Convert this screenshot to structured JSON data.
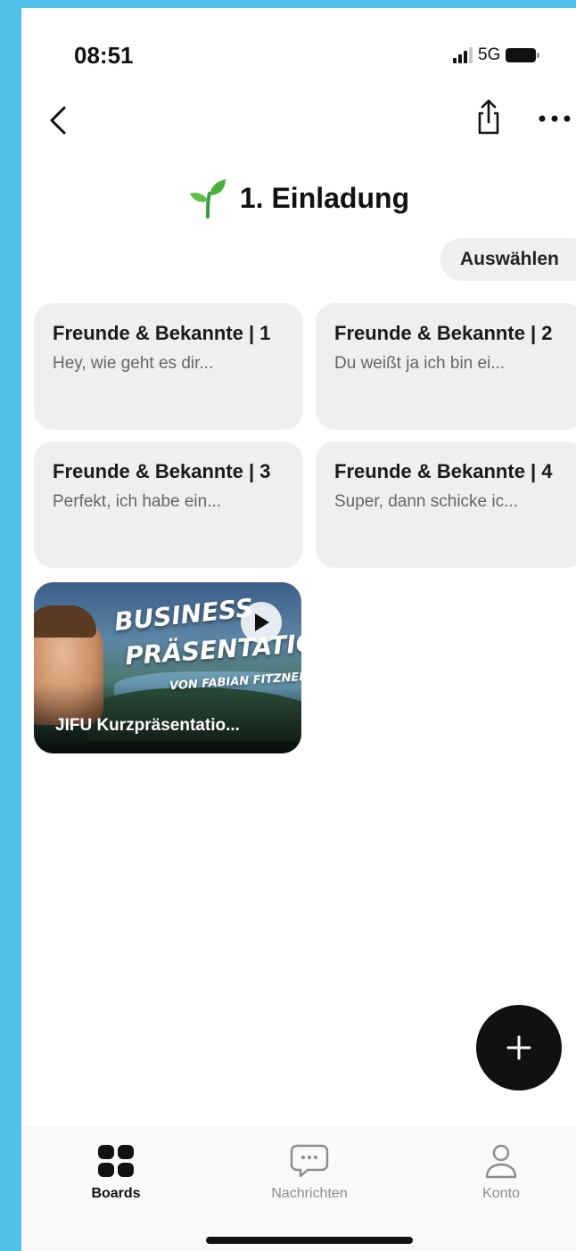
{
  "status_bar": {
    "time": "08:51",
    "network": "5G"
  },
  "header": {
    "title": "1. Einladung",
    "select_label": "Auswählen"
  },
  "cards": [
    {
      "title": "Freunde & Bekannte | 1",
      "preview": "Hey, wie geht es dir..."
    },
    {
      "title": "Freunde & Bekannte | 2",
      "preview": "Du weißt ja ich bin ei..."
    },
    {
      "title": "Freunde & Bekannte | 3",
      "preview": "Perfekt, ich habe ein..."
    },
    {
      "title": "Freunde & Bekannte | 4",
      "preview": "Super, dann schicke ic..."
    }
  ],
  "video": {
    "thumbnail_line1": "BUSINESS",
    "thumbnail_line2": "PRÄSENTATION",
    "thumbnail_line3": "VON FABIAN FITZNER",
    "label": "JIFU Kurzpräsentatio..."
  },
  "tabbar": {
    "boards": "Boards",
    "messages": "Nachrichten",
    "account": "Konto"
  },
  "colors": {
    "background": "#4fc0e8",
    "fab": "#111111",
    "card": "#efefef"
  }
}
